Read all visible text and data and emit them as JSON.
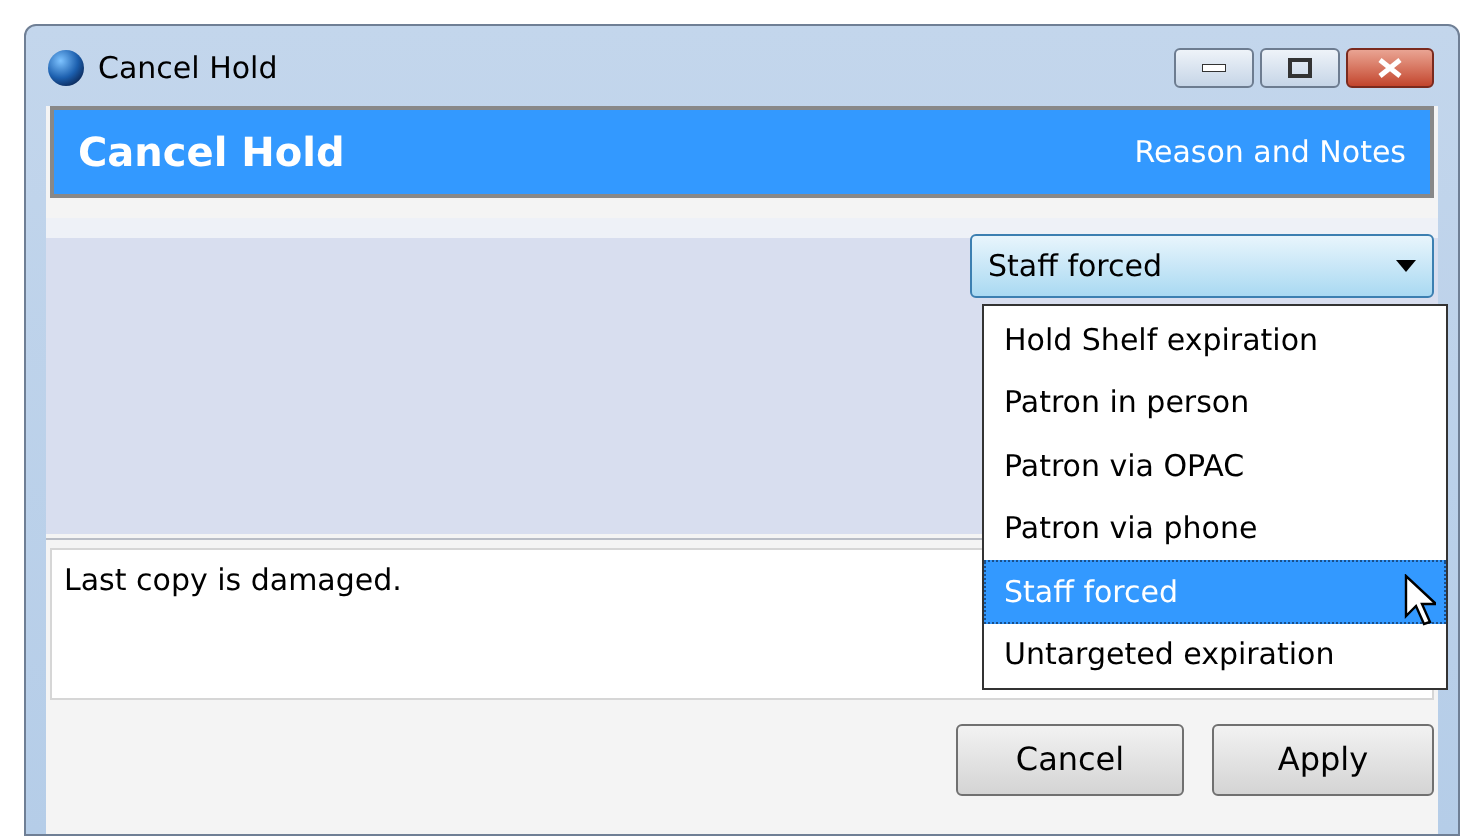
{
  "window": {
    "title": "Cancel Hold"
  },
  "header": {
    "title": "Cancel Hold",
    "subtitle": "Reason and Notes"
  },
  "reason_dropdown": {
    "value": "Staff forced",
    "expanded": true,
    "options": [
      {
        "label": "Hold Shelf expiration",
        "selected": false
      },
      {
        "label": "Patron in person",
        "selected": false
      },
      {
        "label": "Patron via OPAC",
        "selected": false
      },
      {
        "label": "Patron via phone",
        "selected": false
      },
      {
        "label": "Staff forced",
        "selected": true
      },
      {
        "label": "Untargeted expiration",
        "selected": false
      }
    ]
  },
  "notes": {
    "value": "Last copy is damaged."
  },
  "buttons": [
    "Cancel",
    "Apply"
  ]
}
